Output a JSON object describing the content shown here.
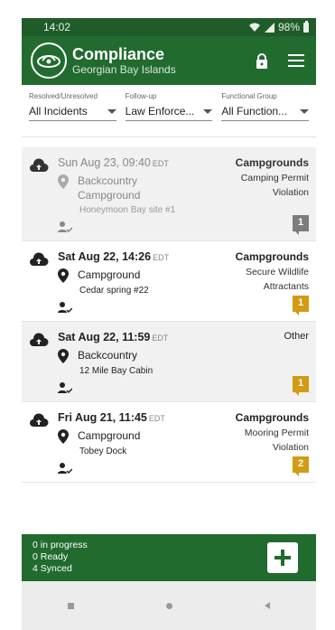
{
  "status_bar": {
    "time": "14:02",
    "battery": "98%"
  },
  "app_bar": {
    "title": "Compliance",
    "subtitle": "Georgian Bay Islands",
    "icons": [
      "lock-icon",
      "menu-icon"
    ]
  },
  "filters": [
    {
      "label": "Resolved/Unresolved",
      "value": "All Incidents"
    },
    {
      "label": "Follow-up",
      "value": "Law Enforce..."
    },
    {
      "label": "Functional Group",
      "value": "All Function..."
    }
  ],
  "incidents": [
    {
      "date": "Sun Aug 23, 09:40",
      "tz": "EDT",
      "location": "Backcountry\nCampground",
      "site": "Honeymoon Bay site #1",
      "category": "Campgrounds",
      "detail": "Camping Permit\nViolation",
      "count": "1",
      "badge_color": "#7c7c7c"
    },
    {
      "date": "Sat Aug 22, 14:26",
      "tz": "EDT",
      "location": "Campground",
      "site": "Cedar spring #22",
      "category": "Campgrounds",
      "detail": "Secure Wildlife\nAttractants",
      "count": "1",
      "badge_color": "#d39a14"
    },
    {
      "date": "Sat Aug 22, 11:59",
      "tz": "EDT",
      "location": "Backcountry",
      "site": "12 Mile Bay Cabin",
      "category": "Other",
      "detail": "",
      "count": "1",
      "badge_color": "#d39a14"
    },
    {
      "date": "Fri Aug 21, 11:45",
      "tz": "EDT",
      "location": "Campground",
      "site": "Tobey Dock",
      "category": "Campgrounds",
      "detail": "Mooring Permit\nViolation",
      "count": "2",
      "badge_color": "#d39a14"
    }
  ],
  "bottom_bar": {
    "in_progress": "0 in progress",
    "ready": "0 Ready",
    "synced": "4 Synced"
  },
  "colors": {
    "header": "#216b2f",
    "statusbar": "#1f5c2a",
    "badge_pending": "#7c7c7c",
    "badge_active": "#d39a14"
  }
}
